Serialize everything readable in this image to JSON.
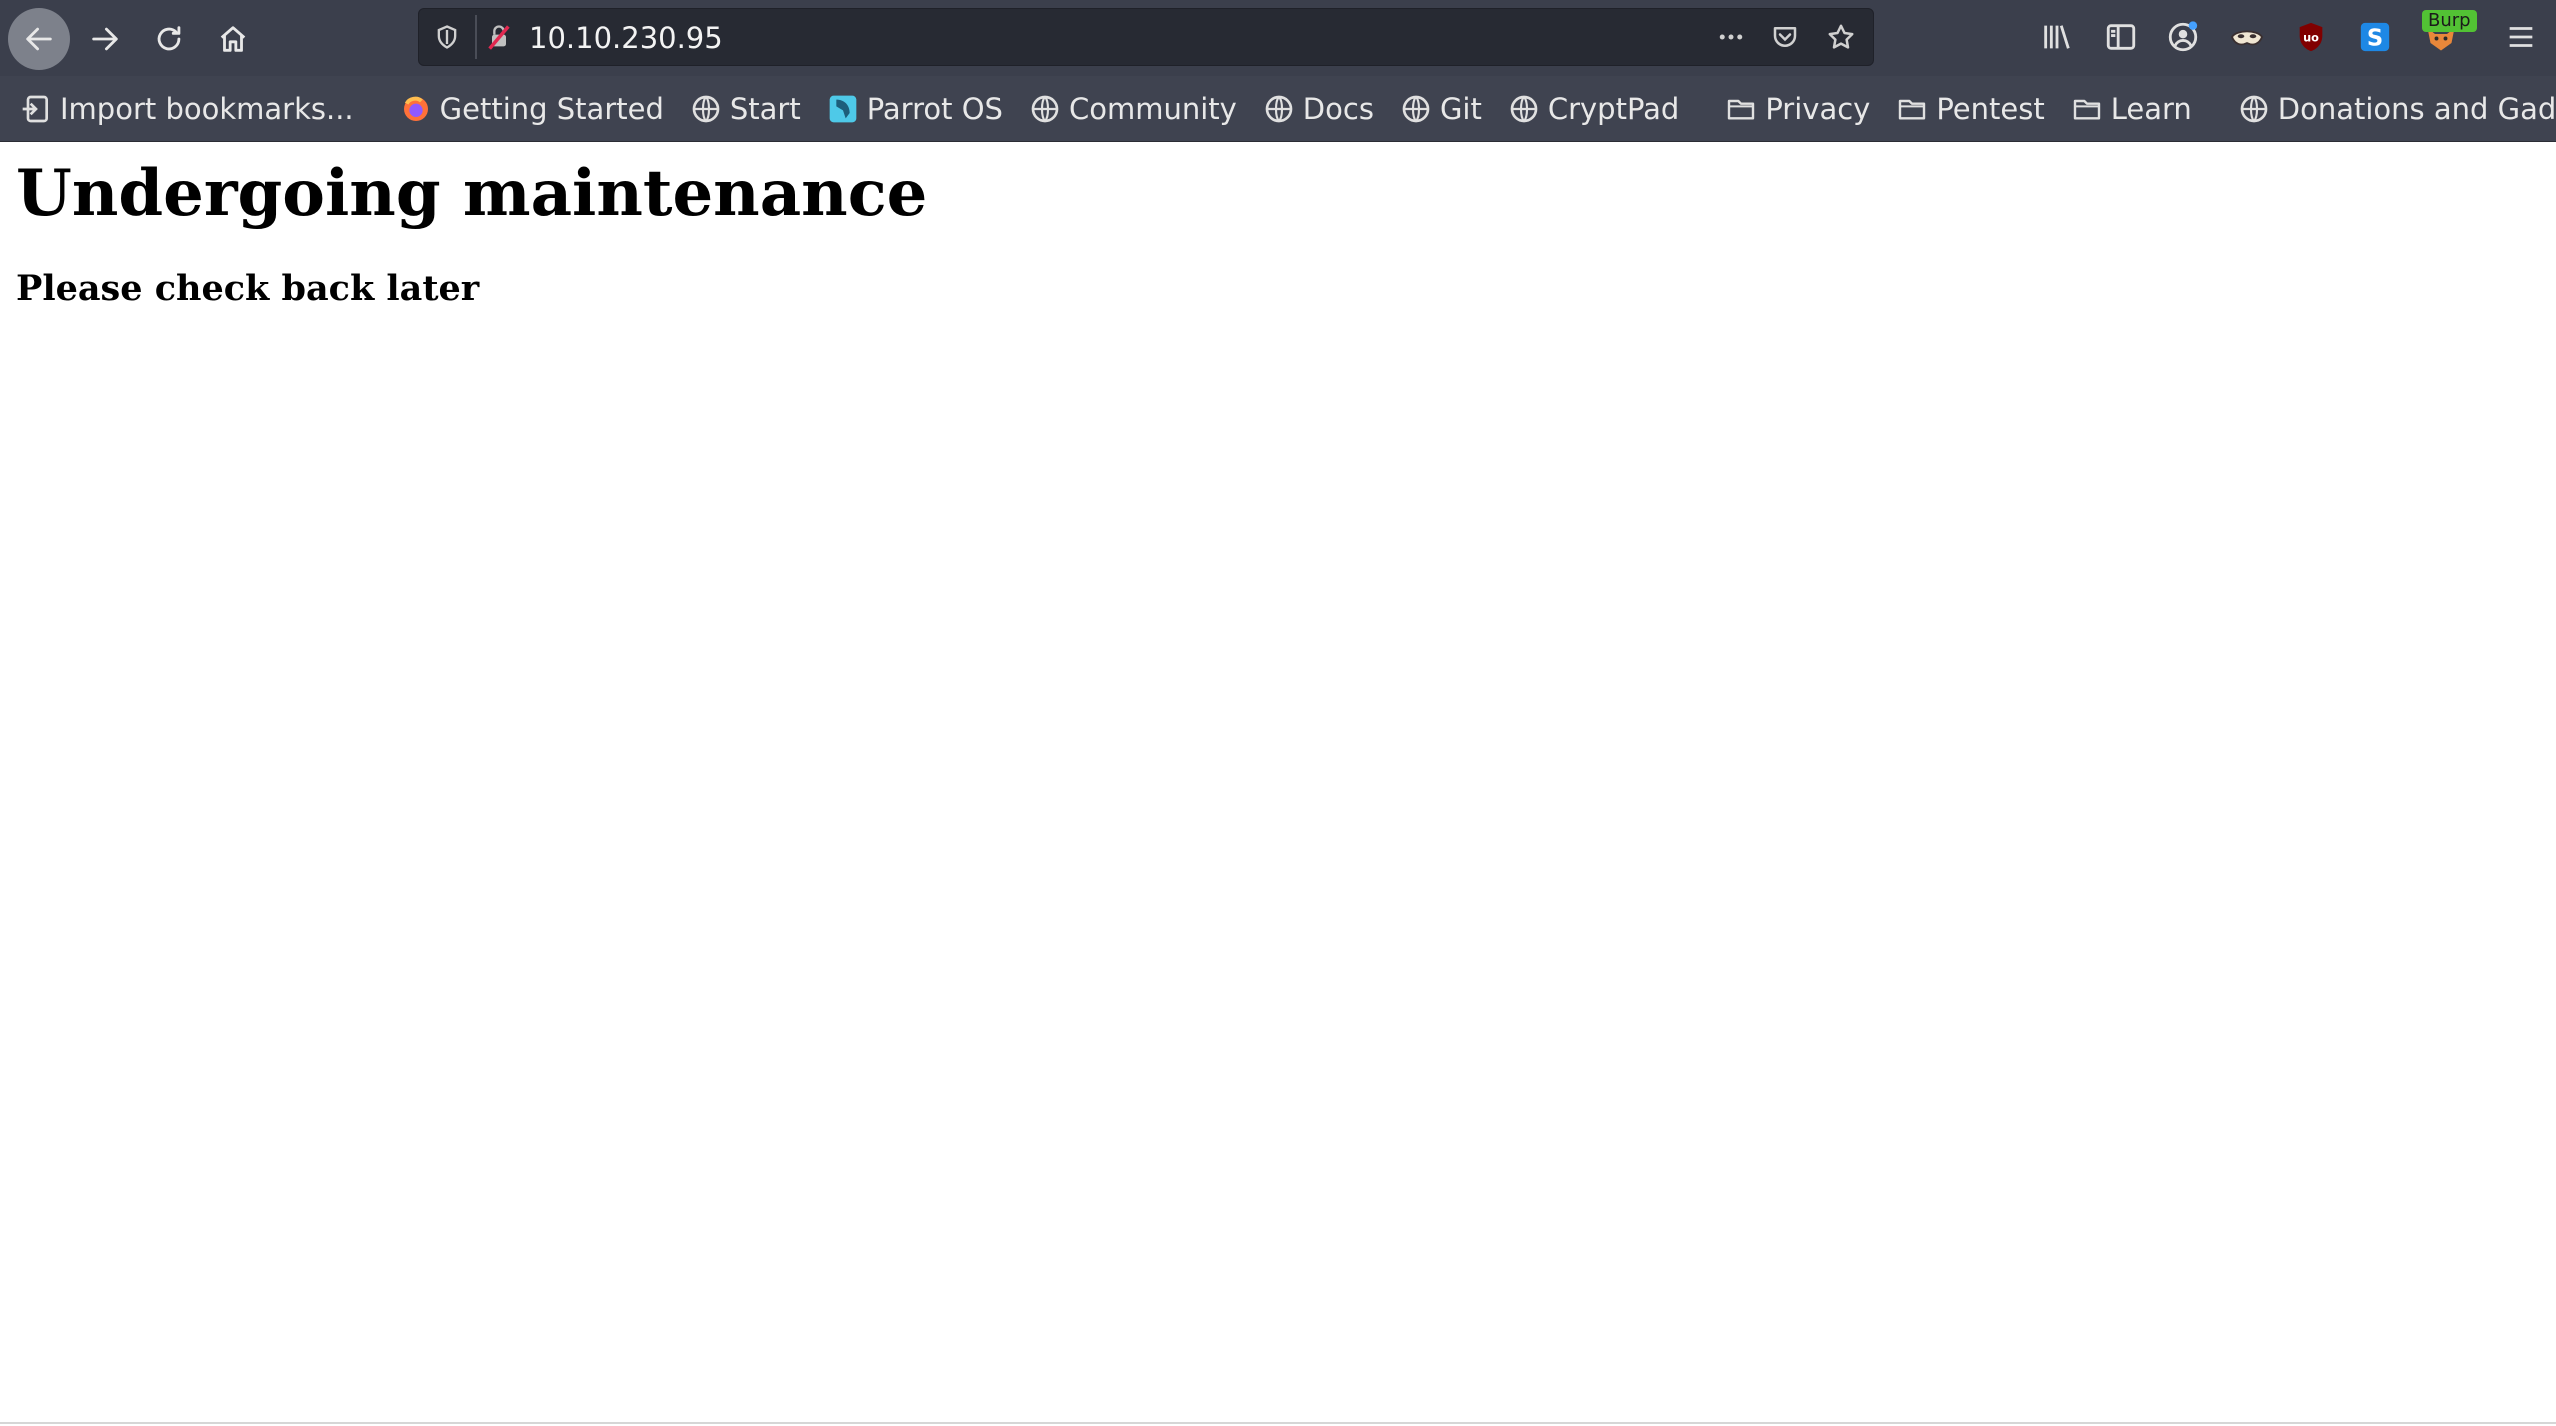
{
  "browser": {
    "url": "10.10.230.95",
    "toolbar_icons": [
      "back-icon",
      "forward-icon",
      "reload-icon",
      "home-icon",
      "shield-icon",
      "insecure-lock-icon",
      "more-icon",
      "pocket-icon",
      "bookmark-star-icon",
      "library-icon",
      "sidebar-icon",
      "account-icon",
      "mask-extension-icon",
      "ublock-icon",
      "s-extension-icon",
      "foxyproxy-icon",
      "hamburger-menu-icon"
    ],
    "burp_badge": "Burp"
  },
  "bookmarks": {
    "import": "Import bookmarks...",
    "getting_started": "Getting Started",
    "start": "Start",
    "parrot_os": "Parrot OS",
    "community": "Community",
    "docs": "Docs",
    "git": "Git",
    "cryptpad": "CryptPad",
    "privacy": "Privacy",
    "pentest": "Pentest",
    "learn": "Learn",
    "donations": "Donations and Gadgets"
  },
  "page": {
    "heading": "Undergoing maintenance",
    "subheading": "Please check back later"
  },
  "colors": {
    "chrome_bg": "#3f4350",
    "urlbar_bg": "#272a33",
    "accent_insecure": "#e22850",
    "page_bg": "#ffffff"
  }
}
